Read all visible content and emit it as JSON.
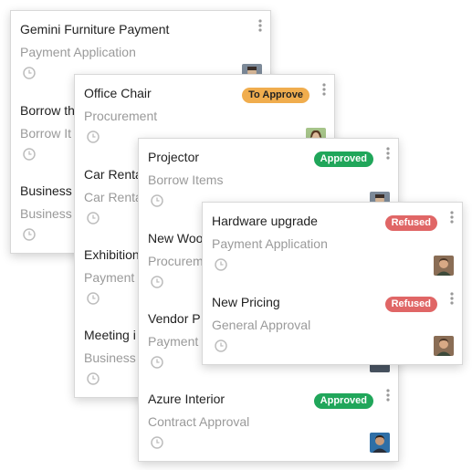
{
  "columns": [
    {
      "cards": [
        {
          "title": "Gemini Furniture Payment",
          "subtitle": "Payment Application",
          "badge": "",
          "avatar": "avatar-user"
        },
        {
          "title": "Borrow th",
          "subtitle": "Borrow It",
          "badge": "",
          "avatar": ""
        },
        {
          "title": "Business",
          "subtitle": "Business",
          "badge": "",
          "avatar": ""
        }
      ]
    },
    {
      "cards": [
        {
          "title": "Office Chair",
          "subtitle": "Procurement",
          "badge": "To Approve",
          "avatar": "avatar-woman"
        },
        {
          "title": "Car Renta",
          "subtitle": "Car Renta",
          "badge": "",
          "avatar": ""
        },
        {
          "title": "Exhibition",
          "subtitle": "Payment",
          "badge": "",
          "avatar": ""
        },
        {
          "title": "Meeting i",
          "subtitle": "Business",
          "badge": "",
          "avatar": ""
        }
      ]
    },
    {
      "cards": [
        {
          "title": "Projector",
          "subtitle": "Borrow Items",
          "badge": "Approved",
          "avatar": "avatar-user"
        },
        {
          "title": "New Woo",
          "subtitle": "Procurem",
          "badge": "",
          "avatar": ""
        },
        {
          "title": "Vendor P",
          "subtitle": "Payment",
          "badge": "",
          "avatar": "avatar-user"
        },
        {
          "title": "Azure Interior",
          "subtitle": "Contract Approval",
          "badge": "Approved",
          "avatar": "avatar-man"
        }
      ]
    },
    {
      "cards": [
        {
          "title": "Hardware upgrade",
          "subtitle": "Payment Application",
          "badge": "Refused",
          "avatar": "avatar-man"
        },
        {
          "title": "New Pricing",
          "subtitle": "General Approval",
          "badge": "Refused",
          "avatar": "avatar-man"
        }
      ]
    }
  ],
  "colors": {
    "to_approve": "#f0ad4e",
    "approved": "#20a65a",
    "refused": "#e06666"
  }
}
